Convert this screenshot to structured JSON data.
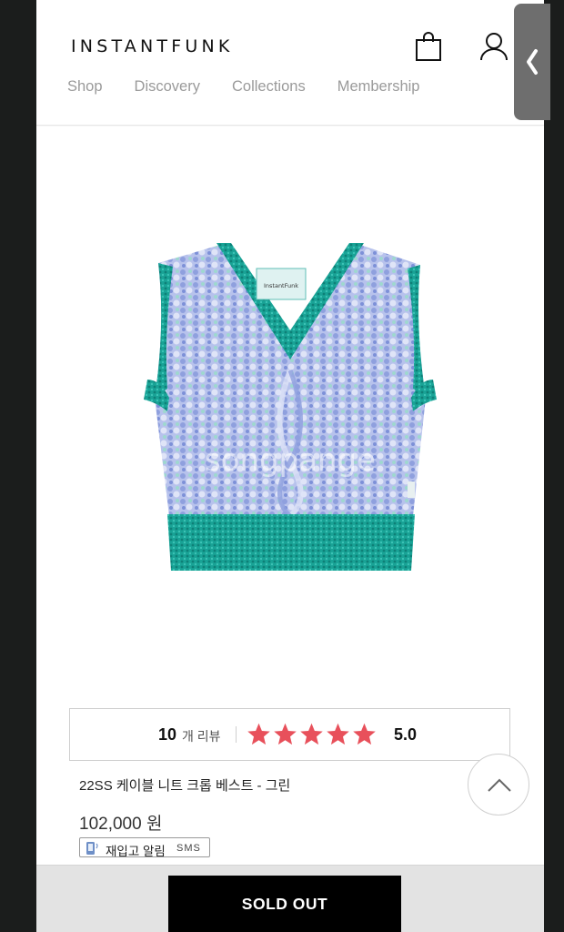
{
  "header": {
    "logo": "INSTANTFUNK",
    "nav": [
      "Shop",
      "Discovery",
      "Collections",
      "Membership"
    ],
    "icons": {
      "cart": "shopping-bag-icon",
      "account": "user-icon",
      "side_tab": "chevron-left-icon"
    }
  },
  "product": {
    "image_label": "InstantFunk",
    "watermark": "songpange",
    "review": {
      "count": "10",
      "count_label": "개 리뷰",
      "rating_value": 5,
      "rating_max": 5,
      "score": "5.0",
      "star_color": "#e8505b"
    },
    "name": "22SS 케이블 니트 크롭 베스트 - 그린",
    "price": "102,000 원",
    "restock": {
      "label": "재입고 알림",
      "sms": "SMS"
    }
  },
  "actions": {
    "sold_out": "SOLD OUT"
  },
  "colors": {
    "knit_trim": "#1fa39a",
    "knit_body": "#a9b8e8",
    "button_bg": "#000000"
  }
}
